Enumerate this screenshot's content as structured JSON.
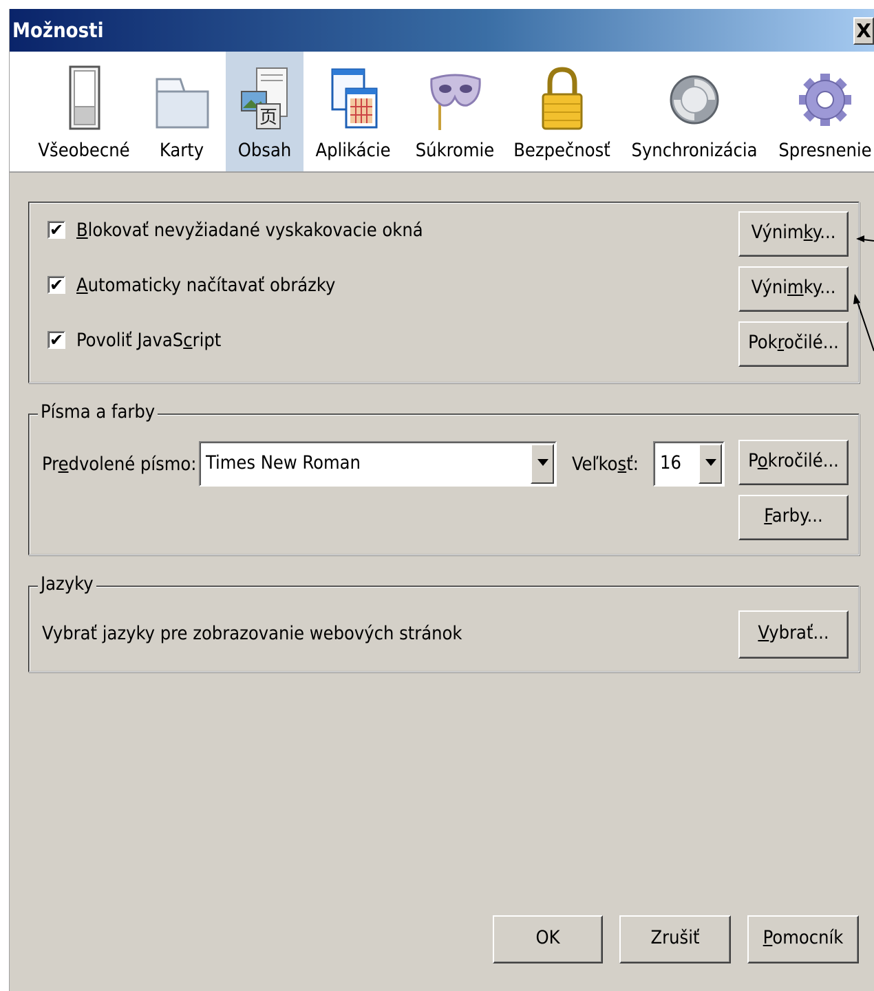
{
  "window": {
    "title": "Možnosti",
    "close_label": "X"
  },
  "toolbar": {
    "items": [
      {
        "label": "Všeobecné",
        "icon": "switch-icon"
      },
      {
        "label": "Karty",
        "icon": "folder-tab-icon"
      },
      {
        "label": "Obsah",
        "icon": "content-icon",
        "selected": true
      },
      {
        "label": "Aplikácie",
        "icon": "applications-icon"
      },
      {
        "label": "Súkromie",
        "icon": "mask-icon"
      },
      {
        "label": "Bezpečnosť",
        "icon": "padlock-icon"
      },
      {
        "label": "Synchronizácia",
        "icon": "sync-icon"
      },
      {
        "label": "Spresnenie",
        "icon": "gear-icon"
      }
    ]
  },
  "content_group": {
    "popups": {
      "checked": true,
      "label_pre": "",
      "label_key": "B",
      "label_post": "lokovať nevyžiadané vyskakovacie okná",
      "button_pre": "Výnim",
      "button_key": "k",
      "button_post": "y..."
    },
    "images": {
      "checked": true,
      "label_pre": "",
      "label_key": "A",
      "label_post": "utomaticky načítavať obrázky",
      "button_pre": "Výni",
      "button_key": "m",
      "button_post": "ky..."
    },
    "javascript": {
      "checked": true,
      "label_pre": "Povoliť JavaS",
      "label_key": "c",
      "label_post": "ript",
      "button_pre": "Pok",
      "button_key": "r",
      "button_post": "očilé..."
    }
  },
  "fonts_group": {
    "legend": "Písma a farby",
    "default_font_label_pre": "Pr",
    "default_font_label_key": "e",
    "default_font_label_post": "dvolené písmo:",
    "default_font_value": "Times New Roman",
    "size_label_pre": "Veľko",
    "size_label_key": "s",
    "size_label_post": "ť:",
    "size_value": "16",
    "advanced_pre": "P",
    "advanced_key": "o",
    "advanced_post": "kročilé...",
    "colors_pre": "",
    "colors_key": "F",
    "colors_post": "arby..."
  },
  "languages_group": {
    "legend": "Jazyky",
    "text": "Vybrať jazyky pre zobrazovanie webových stránok",
    "choose_pre": "",
    "choose_key": "V",
    "choose_post": "ybrať..."
  },
  "footer": {
    "ok": "OK",
    "cancel": "Zrušiť",
    "help_pre": "",
    "help_key": "P",
    "help_post": "omocník"
  },
  "colors": {
    "titlebar_start": "#0a246a",
    "titlebar_end": "#a6caf0",
    "dialog_bg": "#d4d0c8",
    "selected_tab": "#c8d6e6"
  }
}
